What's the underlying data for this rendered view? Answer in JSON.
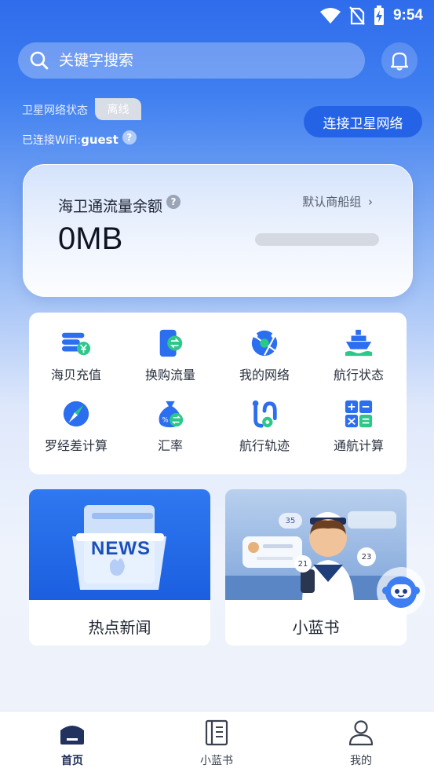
{
  "status_bar": {
    "time": "9:54"
  },
  "search": {
    "placeholder": "关键字搜索"
  },
  "network": {
    "satellite_label": "卫星网络状态",
    "satellite_status": "离线",
    "wifi_label": "已连接WiFi:",
    "wifi_ssid": "guest",
    "connect_button": "连接卫星网络"
  },
  "quota": {
    "title": "海卫通流量余额",
    "group_link": "默认商船组",
    "value": "0MB"
  },
  "services": [
    {
      "label": "海贝充值",
      "icon": "coin-card-icon"
    },
    {
      "label": "换购流量",
      "icon": "phone-exchange-icon"
    },
    {
      "label": "我的网络",
      "icon": "globe-network-icon"
    },
    {
      "label": "航行状态",
      "icon": "ship-icon"
    },
    {
      "label": "罗经差计算",
      "icon": "compass-icon"
    },
    {
      "label": "汇率",
      "icon": "money-bag-icon"
    },
    {
      "label": "航行轨迹",
      "icon": "route-icon"
    },
    {
      "label": "通航计算",
      "icon": "calculator-icon"
    }
  ],
  "features": [
    {
      "label": "热点新闻",
      "image_text": "NEWS"
    },
    {
      "label": "小蓝书",
      "badges": [
        "35",
        "21",
        "23"
      ]
    }
  ],
  "tabs": [
    {
      "label": "首页",
      "icon": "home-icon",
      "active": true
    },
    {
      "label": "小蓝书",
      "icon": "book-icon",
      "active": false
    },
    {
      "label": "我的",
      "icon": "user-icon",
      "active": false
    }
  ],
  "colors": {
    "primary": "#2563e6",
    "accent_green": "#2bc88a"
  }
}
